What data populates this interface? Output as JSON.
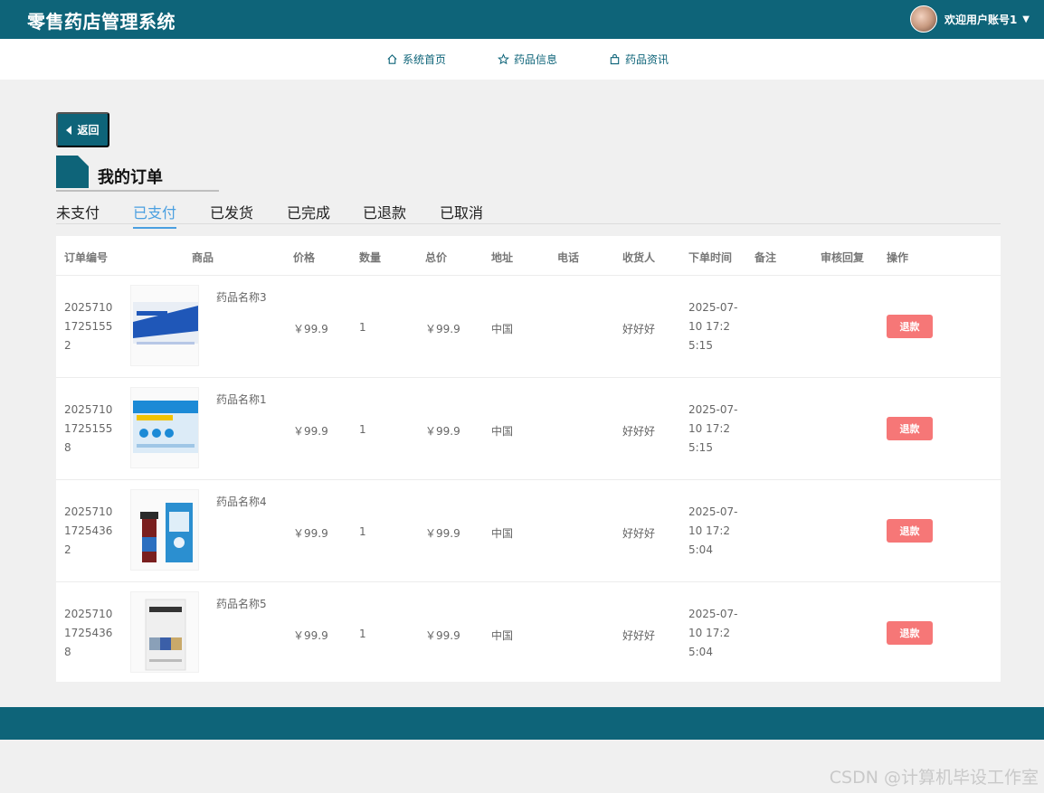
{
  "header": {
    "app_title": "零售药店管理系统",
    "welcome": "欢迎用户账号1"
  },
  "nav": {
    "items": [
      {
        "label": "系统首页",
        "icon": "home-icon"
      },
      {
        "label": "药品信息",
        "icon": "star-icon"
      },
      {
        "label": "药品资讯",
        "icon": "bag-icon"
      }
    ]
  },
  "back_label": "返回",
  "section_title": "我的订单",
  "tabs": [
    "未支付",
    "已支付",
    "已发货",
    "已完成",
    "已退款",
    "已取消"
  ],
  "active_tab": "已支付",
  "table": {
    "columns": [
      "订单编号",
      "商品",
      "价格",
      "数量",
      "总价",
      "地址",
      "电话",
      "收货人",
      "下单时间",
      "备注",
      "审核回复",
      "操作"
    ],
    "rows": [
      {
        "order_no": "20257101725155 2",
        "name": "药品名称3",
        "price": "￥99.9",
        "qty": "1",
        "total": "￥99.9",
        "address": "中国",
        "phone": "",
        "receiver": "好好好",
        "time": "2025-07-10 17:25:15",
        "note": "",
        "reply": "",
        "action": "退款",
        "thumb": {
          "top": "#dfe6ef",
          "band": "#1f57b8",
          "text": "盐酸左西替利嗪片"
        }
      },
      {
        "order_no": "20257101725155 8",
        "name": "药品名称1",
        "price": "￥99.9",
        "qty": "1",
        "total": "￥99.9",
        "address": "中国",
        "phone": "",
        "receiver": "好好好",
        "time": "2025-07-10 17:25:15",
        "note": "",
        "reply": "",
        "action": "退款",
        "thumb": {
          "top": "#cfe6f7",
          "band": "#1c8ad6",
          "text": "奥美拉唑肠溶片"
        }
      },
      {
        "order_no": "20257101725436 2",
        "name": "药品名称4",
        "price": "￥99.9",
        "qty": "1",
        "total": "￥99.9",
        "address": "中国",
        "phone": "",
        "receiver": "好好好",
        "time": "2025-07-10 17:25:04",
        "note": "",
        "reply": "",
        "action": "退款",
        "thumb": {
          "top": "#2b8fd0",
          "band": "#7a1f1f",
          "text": "小儿止咳糖浆"
        }
      },
      {
        "order_no": "20257101725436 8",
        "name": "药品名称5",
        "price": "￥99.9",
        "qty": "1",
        "total": "￥99.9",
        "address": "中国",
        "phone": "",
        "receiver": "好好好",
        "time": "2025-07-10 17:25:04",
        "note": "",
        "reply": "",
        "action": "退款",
        "thumb": {
          "top": "#eeeeee",
          "band": "#c9a96a",
          "text": "维生素C片"
        }
      }
    ]
  },
  "watermark": "CSDN @计算机毕设工作室",
  "colors": {
    "primary": "#0e6479",
    "tab_active": "#4a9fe0",
    "refund": "#f67777"
  }
}
